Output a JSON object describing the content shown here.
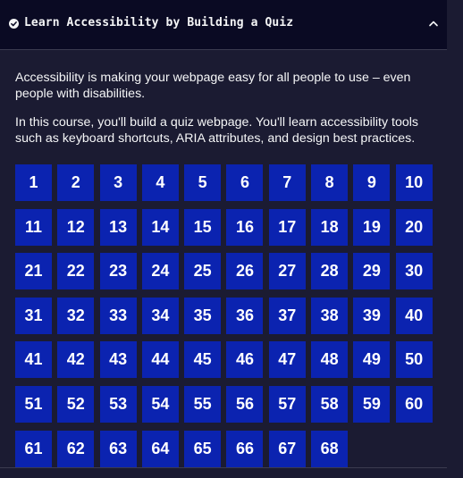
{
  "header": {
    "title": "Learn Accessibility by Building a Quiz",
    "status_icon": "check-circle-icon",
    "toggle_icon": "chevron-up-icon"
  },
  "description": {
    "paragraph_1": "Accessibility is making your webpage easy for all people to use – even people with disabilities.",
    "paragraph_2": "In this course, you'll build a quiz webpage. You'll learn accessibility tools such as keyboard shortcuts, ARIA attributes, and design best practices."
  },
  "steps": [
    "1",
    "2",
    "3",
    "4",
    "5",
    "6",
    "7",
    "8",
    "9",
    "10",
    "11",
    "12",
    "13",
    "14",
    "15",
    "16",
    "17",
    "18",
    "19",
    "20",
    "21",
    "22",
    "23",
    "24",
    "25",
    "26",
    "27",
    "28",
    "29",
    "30",
    "31",
    "32",
    "33",
    "34",
    "35",
    "36",
    "37",
    "38",
    "39",
    "40",
    "41",
    "42",
    "43",
    "44",
    "45",
    "46",
    "47",
    "48",
    "49",
    "50",
    "51",
    "52",
    "53",
    "54",
    "55",
    "56",
    "57",
    "58",
    "59",
    "60",
    "61",
    "62",
    "63",
    "64",
    "65",
    "66",
    "67",
    "68"
  ],
  "colors": {
    "background": "#0a0a23",
    "panel": "#1b1b32",
    "step_button": "#0b23b0",
    "text": "#f5f6f7"
  }
}
